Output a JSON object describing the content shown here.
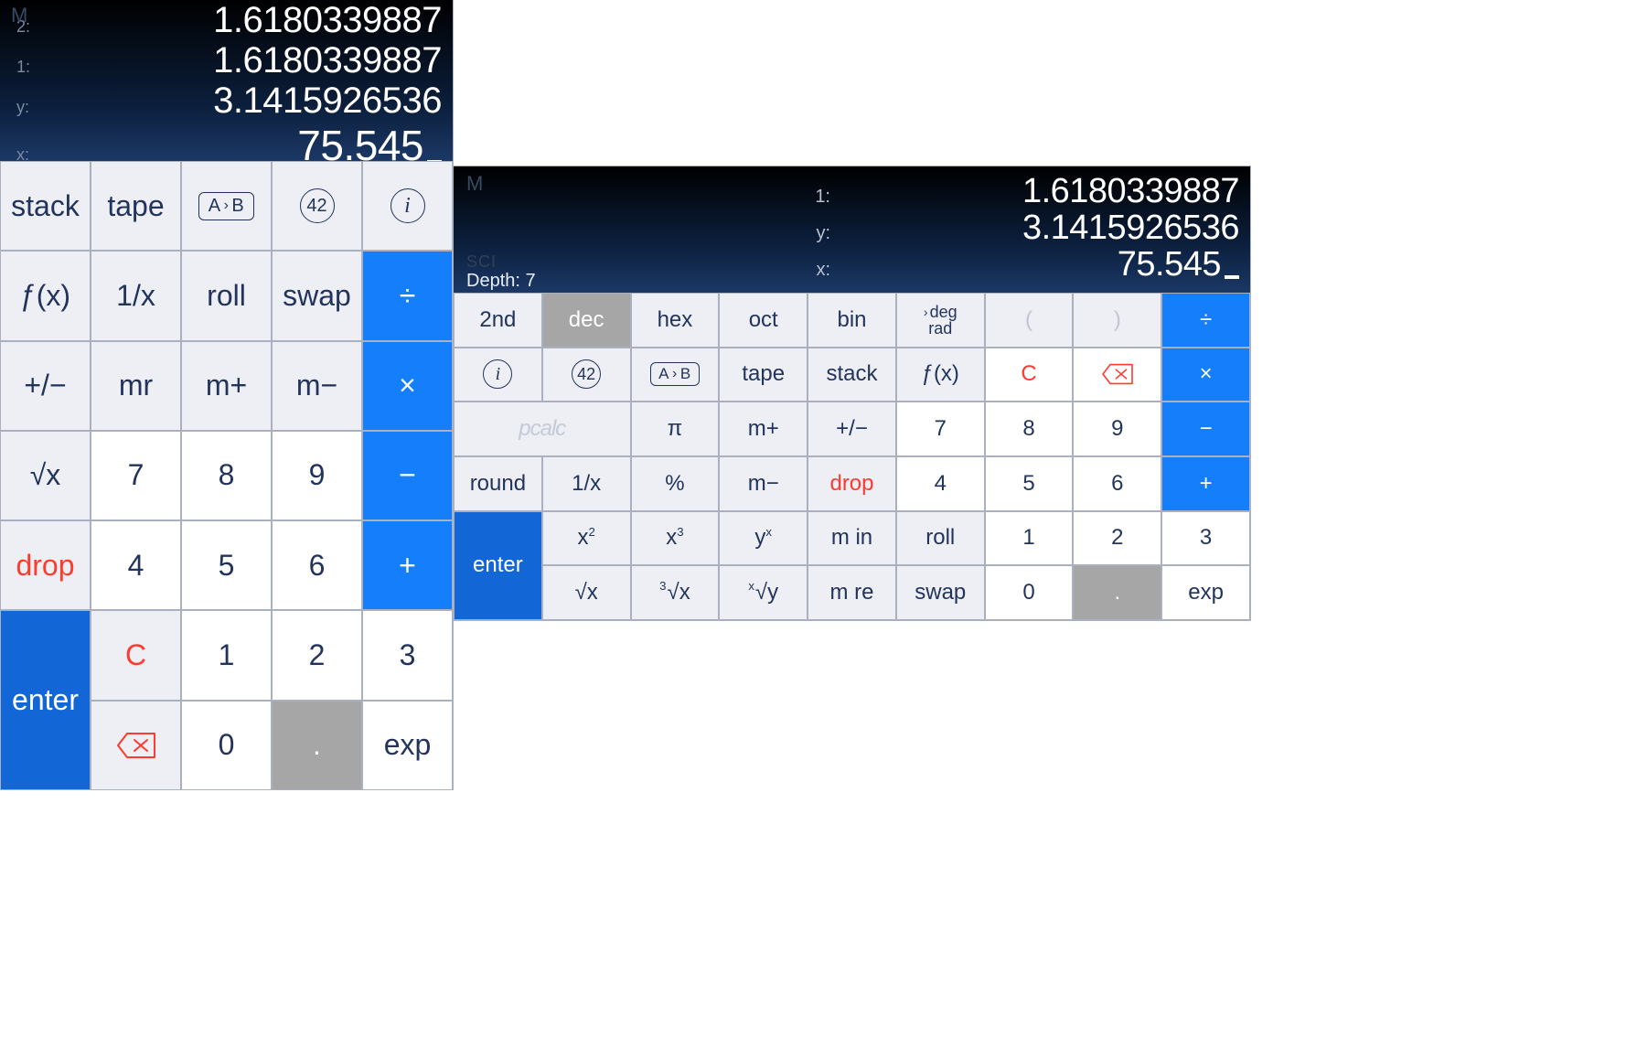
{
  "portrait": {
    "display": {
      "m": "M",
      "rows": [
        {
          "label": "2:",
          "value": "1.6180339887"
        },
        {
          "label": "1:",
          "value": "1.6180339887"
        },
        {
          "label": "y:",
          "value": "3.1415926536"
        },
        {
          "label": "x:",
          "value": "75.545"
        }
      ]
    },
    "keys": {
      "stack": "stack",
      "tape": "tape",
      "ab": "A › B",
      "fortytwo": "42",
      "info": "i",
      "fx": "ƒ(x)",
      "recip": "1/x",
      "roll": "roll",
      "swap": "swap",
      "div": "÷",
      "pm": "+/−",
      "mr": "mr",
      "mplus": "m+",
      "mminus": "m−",
      "mul": "×",
      "sqrt": "√x",
      "seven": "7",
      "eight": "8",
      "nine": "9",
      "minus": "−",
      "drop": "drop",
      "four": "4",
      "five": "5",
      "six": "6",
      "plus": "+",
      "clear": "C",
      "one": "1",
      "two": "2",
      "three": "3",
      "zero": "0",
      "dot": ".",
      "exp": "exp",
      "enter": "enter"
    }
  },
  "landscape": {
    "display": {
      "m": "M",
      "sci": "SCI",
      "depth": "Depth: 7",
      "rows": [
        {
          "label": "1:",
          "value": "1.6180339887"
        },
        {
          "label": "y:",
          "value": "3.1415926536"
        },
        {
          "label": "x:",
          "value": "75.545"
        }
      ]
    },
    "keys": {
      "second": "2nd",
      "dec": "dec",
      "hex": "hex",
      "oct": "oct",
      "bin": "bin",
      "deg": "deg",
      "rad": "rad",
      "lparen": "(",
      "rparen": ")",
      "div": "÷",
      "info": "i",
      "fortytwo": "42",
      "ab": "A › B",
      "tape": "tape",
      "stack": "stack",
      "fx": "ƒ(x)",
      "clear": "C",
      "mul": "×",
      "pcalc": "pcalc",
      "pi": "π",
      "mplus": "m+",
      "pm": "+/−",
      "seven": "7",
      "eight": "8",
      "nine": "9",
      "minus": "−",
      "round": "round",
      "recip": "1/x",
      "percent": "%",
      "mminus": "m−",
      "drop": "drop",
      "four": "4",
      "five": "5",
      "six": "6",
      "plus": "+",
      "x2_base": "x",
      "x2_exp": "2",
      "x3_base": "x",
      "x3_exp": "3",
      "yx_base": "y",
      "yx_exp": "x",
      "min": "m in",
      "roll": "roll",
      "one": "1",
      "two": "2",
      "three": "3",
      "sqrt": "√x",
      "cbrt_pre": "3",
      "cbrt": "√x",
      "xry_pre": "x",
      "xry": "√y",
      "mre": "m re",
      "swap": "swap",
      "zero": "0",
      "dot": ".",
      "exp": "exp",
      "enter": "enter"
    }
  }
}
